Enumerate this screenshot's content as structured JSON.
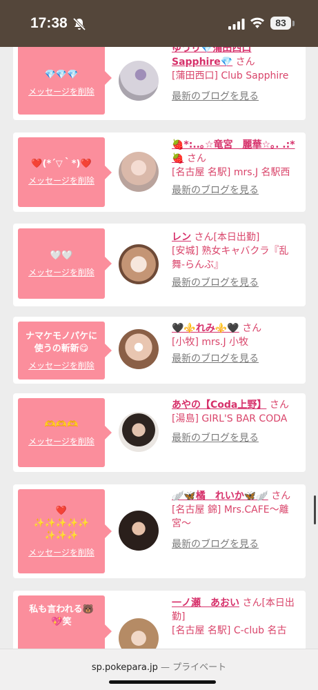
{
  "status_bar": {
    "time": "17:38",
    "battery": "83"
  },
  "cards": [
    {
      "message": "💎💎💎",
      "delete_label": "メッセージを削除",
      "name": "ゆうり💎蒲田西口Sapphire💎",
      "san": "さん",
      "shop": "[蒲田西口] Club Sapphire",
      "blog_label": "最新のブログを見る"
    },
    {
      "message": "❤️(*´▽｀*)❤️",
      "delete_label": "メッセージを削除",
      "name": "🍓*:..｡☆竜宮　麗華☆｡. .:*🍓",
      "san": "さん",
      "shop": "[名古屋 名駅] mrs.J 名駅西",
      "blog_label": "最新のブログを見る"
    },
    {
      "message": "🤍🤍",
      "delete_label": "メッセージを削除",
      "name": "レン",
      "san": "さん[本日出勤]",
      "shop": "[安城] 熟女キャバクラ『乱舞-らんぶ』",
      "blog_label": "最新のブログを見る"
    },
    {
      "message": "ナマケモノパケに\n使うの斬新😋",
      "delete_label": "メッセージを削除",
      "name": "🖤⚜️れみ⚜️🖤",
      "san": "さん",
      "shop": "[小牧] mrs.J 小牧",
      "blog_label": "最新のブログを見る"
    },
    {
      "message": "🫶🫶🫶",
      "delete_label": "メッセージを削除",
      "name": "あやの【Coda上野】",
      "san": "さん",
      "shop": "[湯島] GIRL'S BAR CODA",
      "blog_label": "最新のブログを見る"
    },
    {
      "message": "❤️\n✨✨✨✨✨\n✨✨✨",
      "delete_label": "メッセージを削除",
      "name": "🪽🦋橘　れいか🦋🪽",
      "san": "さん",
      "shop": "[名古屋 錦] Mrs.CAFE〜離宮〜",
      "blog_label": "最新のブログを見る"
    },
    {
      "message": "私も言われる🐻\n💖笑",
      "delete_label": "メッセージを削除",
      "name": "一ノ瀬　あおい",
      "san": "さん[本日出勤]",
      "shop": "[名古屋 名駅] C-club 名古",
      "blog_label": ""
    }
  ],
  "browser": {
    "domain": "sp.pokepara.jp",
    "mode": "— プライベート"
  }
}
